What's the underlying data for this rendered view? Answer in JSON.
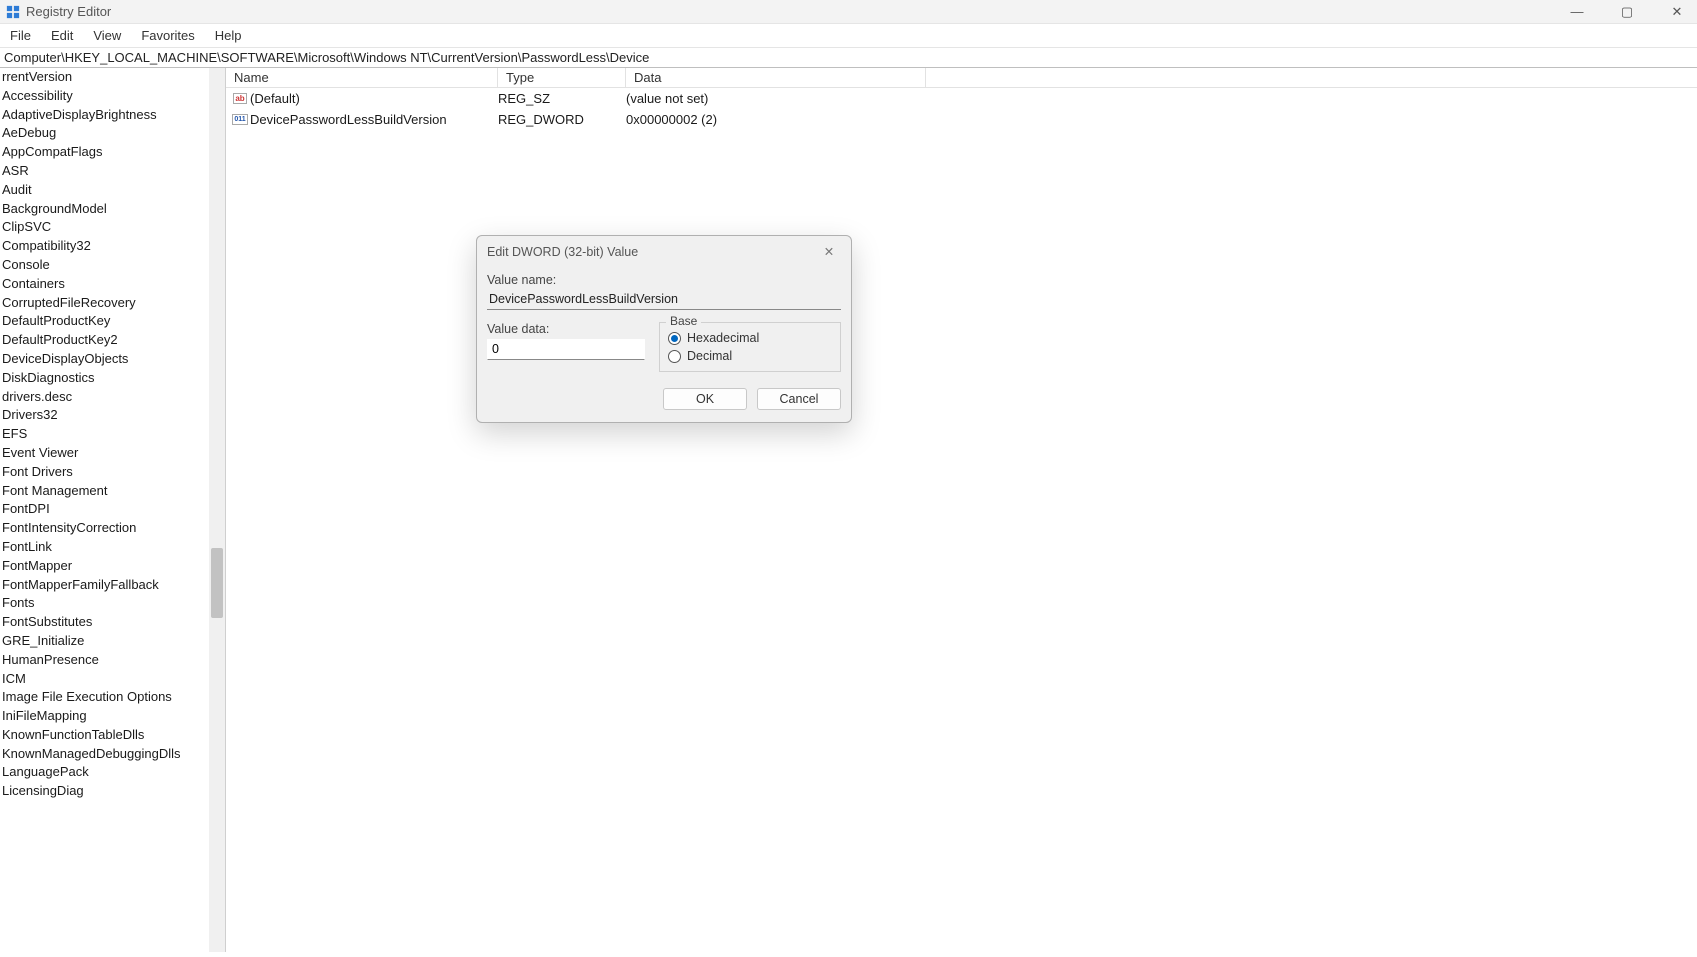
{
  "window": {
    "title": "Registry Editor",
    "controls": {
      "min": "—",
      "max": "▢",
      "close": "✕"
    }
  },
  "menubar": [
    "File",
    "Edit",
    "View",
    "Favorites",
    "Help"
  ],
  "address": "Computer\\HKEY_LOCAL_MACHINE\\SOFTWARE\\Microsoft\\Windows NT\\CurrentVersion\\PasswordLess\\Device",
  "tree": [
    "rrentVersion",
    "Accessibility",
    "AdaptiveDisplayBrightness",
    "AeDebug",
    "AppCompatFlags",
    "ASR",
    "Audit",
    "BackgroundModel",
    "ClipSVC",
    "Compatibility32",
    "Console",
    "Containers",
    "CorruptedFileRecovery",
    "DefaultProductKey",
    "DefaultProductKey2",
    "DeviceDisplayObjects",
    "DiskDiagnostics",
    "drivers.desc",
    "Drivers32",
    "EFS",
    "Event Viewer",
    "Font Drivers",
    "Font Management",
    "FontDPI",
    "FontIntensityCorrection",
    "FontLink",
    "FontMapper",
    "FontMapperFamilyFallback",
    "Fonts",
    "FontSubstitutes",
    "GRE_Initialize",
    "HumanPresence",
    "ICM",
    "Image File Execution Options",
    "IniFileMapping",
    "KnownFunctionTableDlls",
    "KnownManagedDebuggingDlls",
    "LanguagePack",
    "LicensingDiag"
  ],
  "values": {
    "headers": {
      "name": "Name",
      "type": "Type",
      "data": "Data"
    },
    "rows": [
      {
        "icon": "sz",
        "name": "(Default)",
        "type": "REG_SZ",
        "data": "(value not set)"
      },
      {
        "icon": "dw",
        "name": "DevicePasswordLessBuildVersion",
        "type": "REG_DWORD",
        "data": "0x00000002 (2)"
      }
    ]
  },
  "dialog": {
    "title": "Edit DWORD (32-bit) Value",
    "close_glyph": "✕",
    "value_name_label": "Value name:",
    "value_name": "DevicePasswordLessBuildVersion",
    "value_data_label": "Value data:",
    "value_data": "0",
    "base_legend": "Base",
    "base": {
      "hex": "Hexadecimal",
      "dec": "Decimal",
      "selected": "hex"
    },
    "ok": "OK",
    "cancel": "Cancel"
  }
}
